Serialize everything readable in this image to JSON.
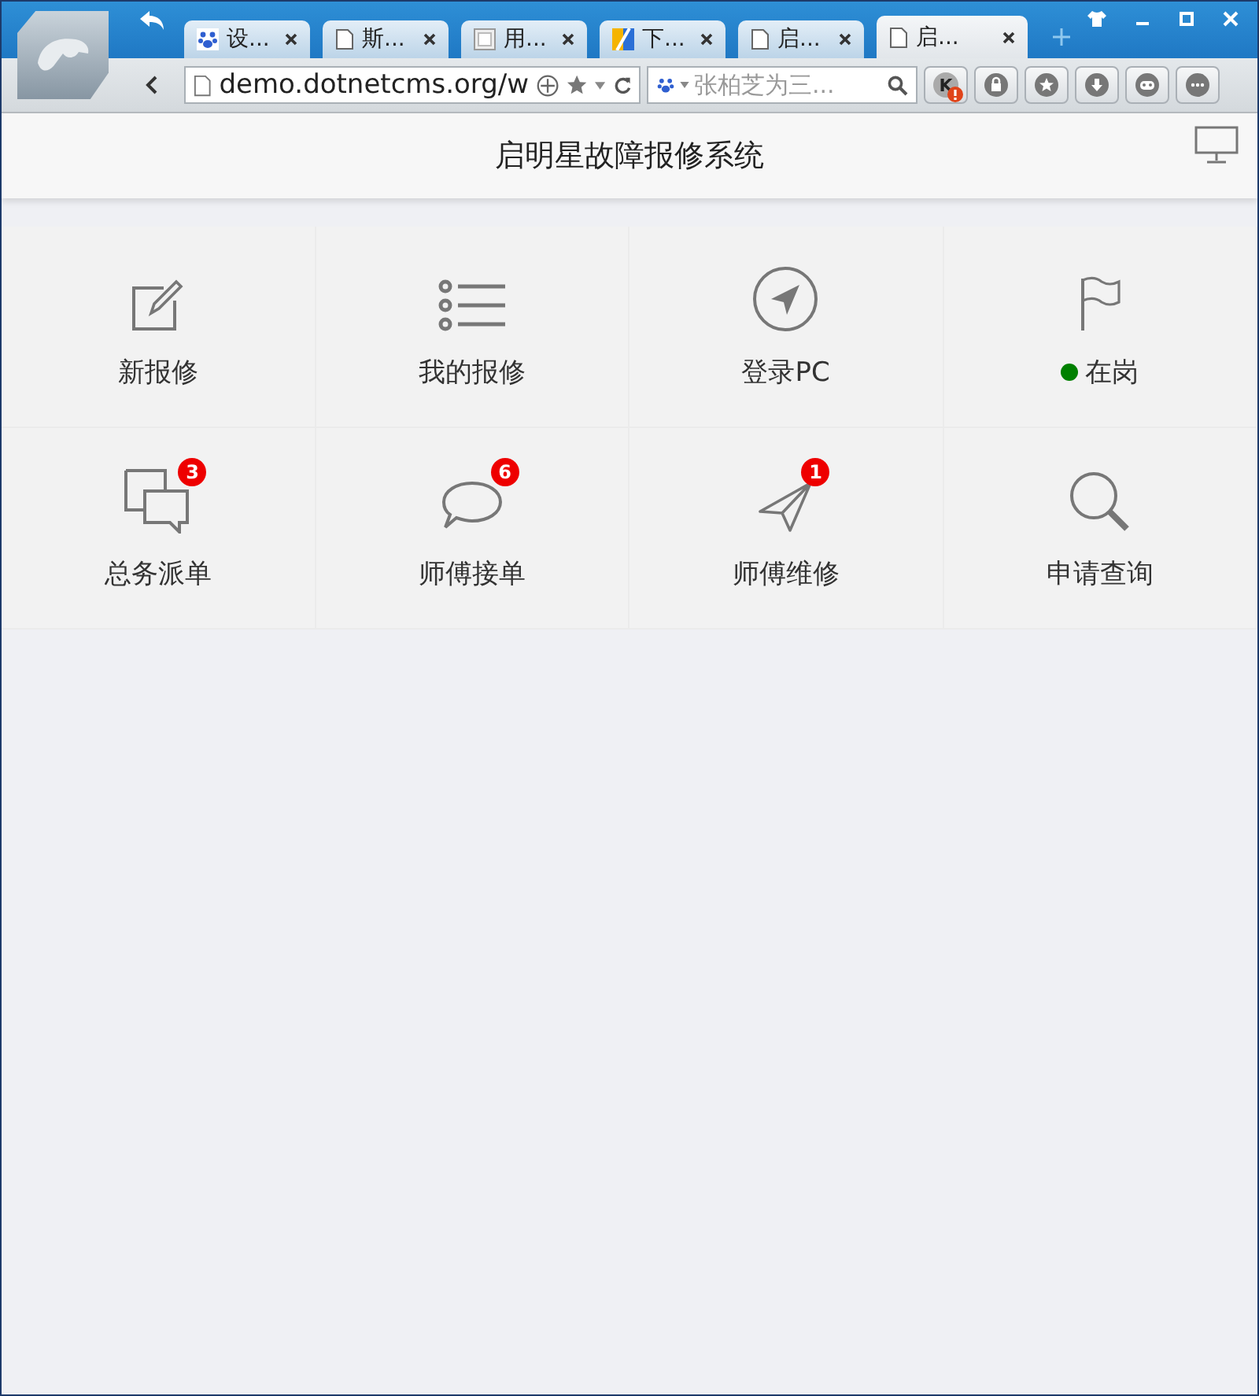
{
  "browser": {
    "tabs": [
      {
        "title": "设...",
        "selected": false
      },
      {
        "title": "斯...",
        "selected": false
      },
      {
        "title": "用...",
        "selected": false
      },
      {
        "title": "下...",
        "selected": false
      },
      {
        "title": "启...",
        "selected": false
      },
      {
        "title": "启...",
        "selected": true
      }
    ],
    "address": "demo.dotnetcms.org/w",
    "search_placeholder": "张柏芝为三...",
    "profile_initial": "K"
  },
  "header": {
    "title": "启明星故障报修系统"
  },
  "tiles": [
    {
      "label": "新报修"
    },
    {
      "label": "我的报修"
    },
    {
      "label": "登录PC"
    },
    {
      "label": "在岗",
      "on_duty": true
    },
    {
      "label": "总务派单",
      "badge": "3"
    },
    {
      "label": "师傅接单",
      "badge": "6"
    },
    {
      "label": "师傅维修",
      "badge": "1"
    },
    {
      "label": "申请查询"
    }
  ]
}
